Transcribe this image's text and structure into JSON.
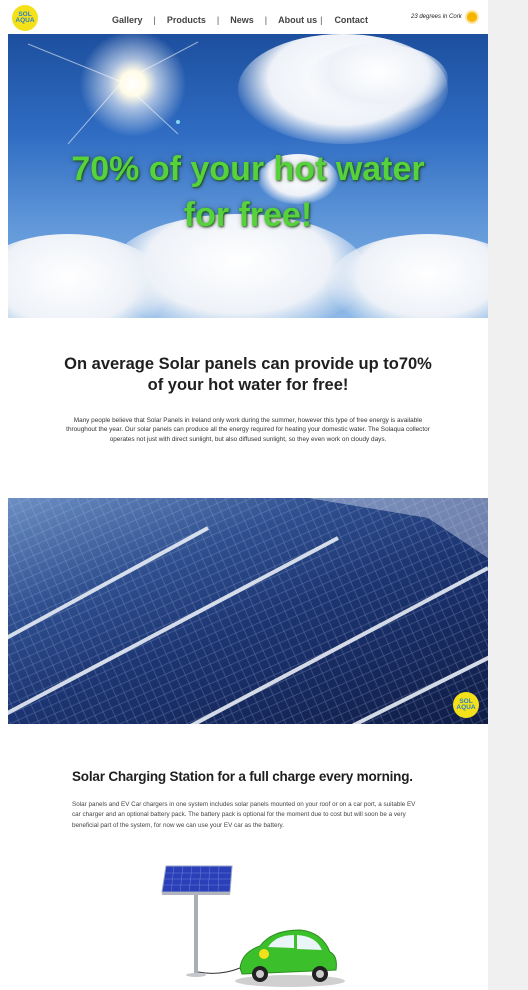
{
  "logo": {
    "line1": "SOL",
    "line2": "AQUA"
  },
  "nav": {
    "items": [
      "Gallery",
      "Products",
      "News",
      "About us",
      "Contact"
    ],
    "separator": "|"
  },
  "weather": {
    "text": "23 degrees in Cork",
    "icon": "sun-icon"
  },
  "hero": {
    "title_line1": "70% of your hot water",
    "title_line2": "for free!"
  },
  "intro": {
    "heading_line1": "On average Solar panels can provide up to70%",
    "heading_line2": "of your hot water for free!",
    "body": "Many people believe that Solar Panels in Ireland only work during the summer, however this type of free energy is available throughout the year. Our solar panels can produce all the energy required for heating your domestic water. The Solaqua collector operates not just with direct sunlight, but also diffused sunlight, so they even work on cloudy days."
  },
  "panels_badge": {
    "line1": "SOL",
    "line2": "AQUA"
  },
  "charging": {
    "heading": "Solar Charging Station for a full charge every morning.",
    "body": "Solar panels and EV Car chargers in one system includes solar panels mounted on your roof or on a car port, a suitable EV car charger and an optional battery pack. The battery pack is optional for the moment due to cost but will soon be a very beneficial part of the system, for now we can use your EV car as the battery."
  },
  "colors": {
    "accent_green": "#56d23a",
    "logo_yellow": "#f4e11a",
    "logo_blue": "#2e7fc4",
    "car_green": "#3bc02b"
  }
}
